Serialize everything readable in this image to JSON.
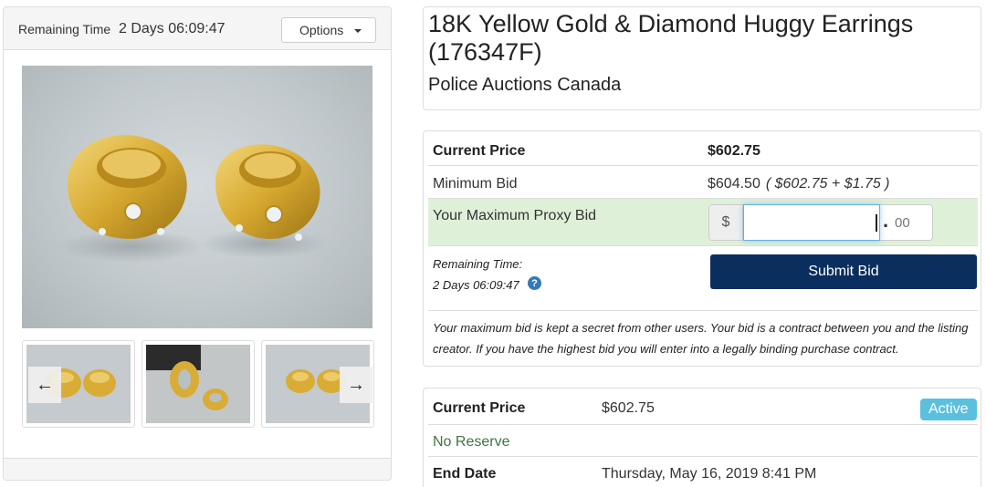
{
  "timer": {
    "label": "Remaining Time",
    "value": "2 Days 06:09:47"
  },
  "options": {
    "label": "Options"
  },
  "listing": {
    "title": "18K Yellow Gold & Diamond Huggy Earrings (176347F)",
    "seller": "Police Auctions Canada"
  },
  "bid": {
    "current_price_label": "Current Price",
    "current_price": "$602.75",
    "min_bid_label": "Minimum Bid",
    "min_bid": "$604.50",
    "min_bid_calc": "( $602.75 + $1.75 )",
    "proxy_label": "Your Maximum Proxy Bid",
    "currency_symbol": "$",
    "amount_value": "",
    "cents_placeholder": "00",
    "remaining_label": "Remaining Time:",
    "remaining_value": "2 Days 06:09:47",
    "help_icon": "?",
    "submit_label": "Submit Bid",
    "disclaimer": "Your maximum bid is kept a secret from other users. Your bid is a contract between you and the listing creator. If you have the highest bid you will enter into a legally binding purchase contract."
  },
  "details": {
    "current_price_label": "Current Price",
    "current_price": "$602.75",
    "status": "Active",
    "reserve": "No Reserve",
    "end_date_label": "End Date",
    "end_date": "Thursday, May 16, 2019 8:41 PM"
  },
  "icons": {
    "prev": "arrow-left-icon",
    "next": "arrow-right-icon",
    "help": "question-circle-icon",
    "caret": "caret-down-icon"
  },
  "colors": {
    "submit": "#0a2f5e",
    "active_badge": "#5bc0de",
    "proxy_row": "#dff0d8",
    "no_reserve": "#3c763d",
    "help_icon": "#337ab7"
  }
}
